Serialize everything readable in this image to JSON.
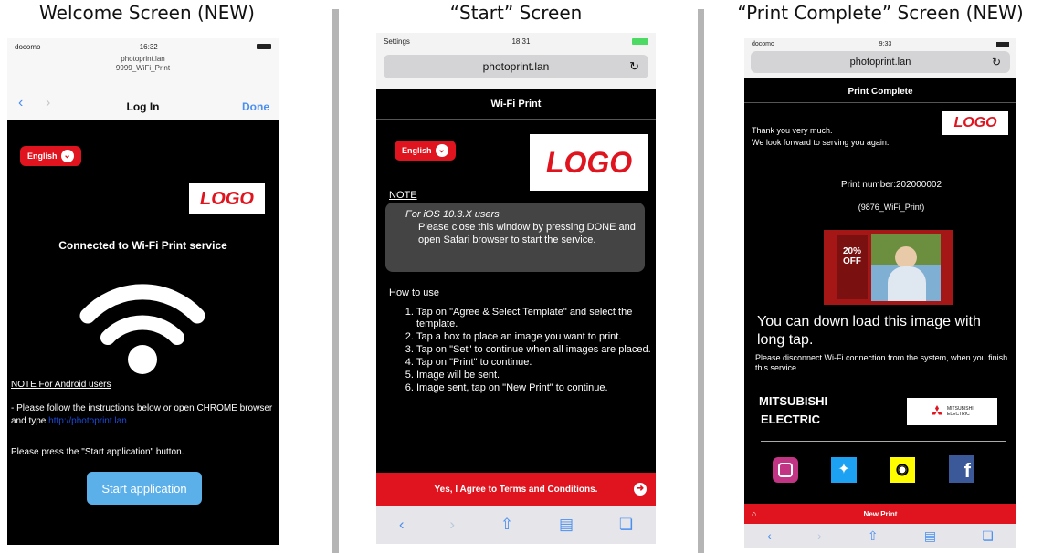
{
  "captions": {
    "welcome": "Welcome Screen (NEW)",
    "start": "“Start” Screen",
    "print_complete": "“Print Complete” Screen (NEW)"
  },
  "welcome": {
    "status_left": "docomo",
    "status_time": "16:32",
    "host": "photoprint.lan",
    "ssid": "9999_WiFi_Print",
    "nav_title": "Log In",
    "nav_done": "Done",
    "language": "English",
    "logo": "LOGO",
    "connected_text": "Connected to Wi-Fi Print service",
    "note_heading": "NOTE For Android users",
    "note_text": "- Please follow the instructions below or open CHROME browser and type",
    "note_link": "http://photoprint.lan",
    "press_text": "Please press the \"Start application\" button.",
    "start_button": "Start application"
  },
  "start": {
    "status_left": "Settings",
    "status_time": "18:31",
    "url": "photoprint.lan",
    "header_title": "Wi-Fi Print",
    "language": "English",
    "logo": "LOGO",
    "note_label": "NOTE",
    "ios_note_title": "For iOS 10.3.X users",
    "ios_note_text": "Please close this window by pressing DONE and open Safari browser to start the service.",
    "howto_label": "How to use",
    "steps": [
      "Tap on \"Agree & Select Template\" and select the template.",
      "Tap a box to place an image you want to print.",
      "Tap on \"Set\" to continue when all images are placed.",
      "Tap on \"Print\" to continue.",
      "Image will be sent.",
      "Image sent, tap on \"New Print\" to continue."
    ],
    "agree_button": "Yes, I Agree to Terms and Conditions."
  },
  "complete": {
    "status_left": "docomo",
    "status_time": "9:33",
    "url": "photoprint.lan",
    "header_title": "Print Complete",
    "thanks": "Thank you very much.",
    "look_forward": "We look forward to serving you again.",
    "logo": "LOGO",
    "print_number": "Print number:202000002",
    "print_ssid": "(9876_WiFi_Print)",
    "sale_text": "20% OFF",
    "download_text": "You can down load this image with long tap.",
    "disconnect_text": "Please disconnect Wi-Fi connection from the system, when you finish this service.",
    "brand_line1": "MITSUBISHI",
    "brand_line2": "ELECTRIC",
    "brand_logo_text": "MITSUBISHI ELECTRIC",
    "new_print": "New Print"
  },
  "colors": {
    "red": "#e0141e",
    "ios_blue": "#4a8ff0",
    "button_blue": "#5bb0ea"
  }
}
